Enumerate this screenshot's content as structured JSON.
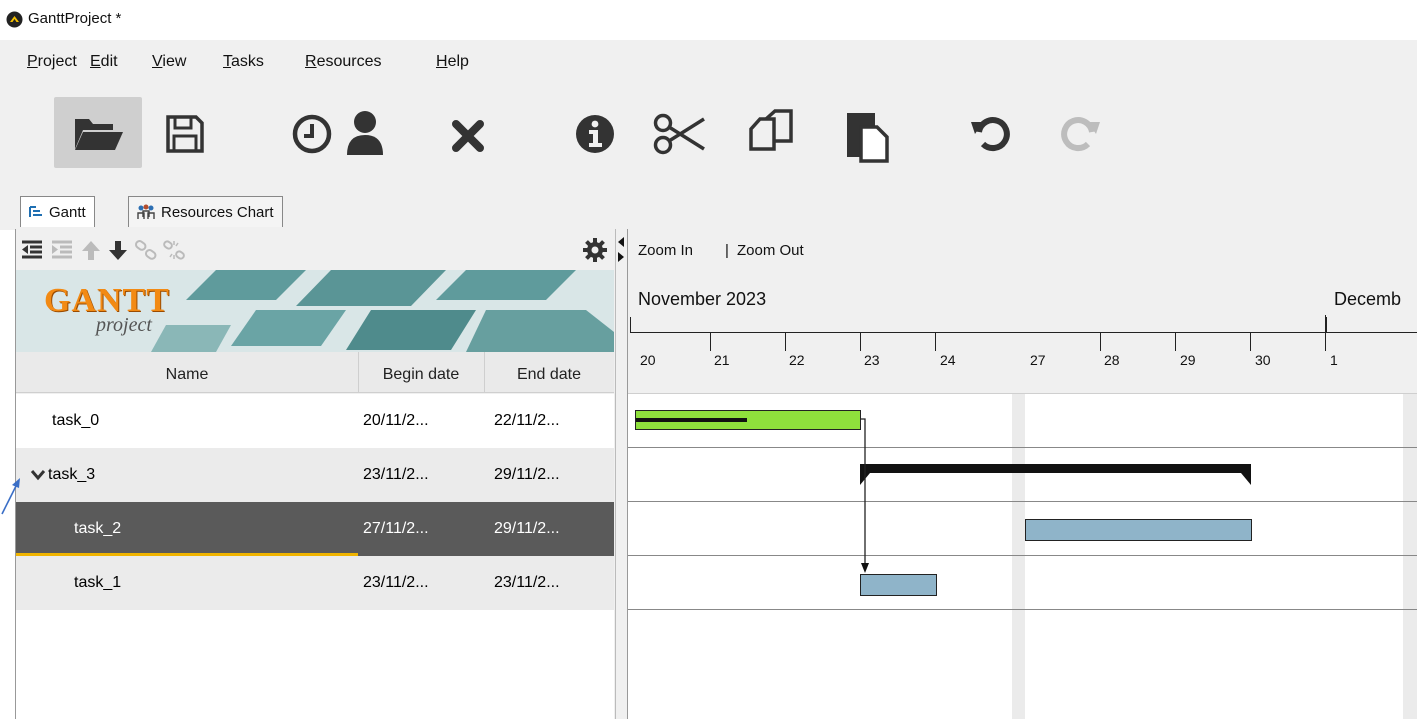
{
  "window": {
    "title": "GanttProject *"
  },
  "menu": {
    "items": [
      "Project",
      "Edit",
      "View",
      "Tasks",
      "Resources",
      "Help"
    ]
  },
  "toolbar": {
    "buttons": [
      "open-folder-icon",
      "save-icon",
      "clock-icon",
      "person-icon",
      "delete-icon",
      "info-icon",
      "cut-icon",
      "copy-icon",
      "paste-icon",
      "undo-icon",
      "redo-icon"
    ]
  },
  "tabs": {
    "gantt": "Gantt",
    "resources": "Resources Chart"
  },
  "logo": {
    "main": "GANTT",
    "sub": "project"
  },
  "table": {
    "headers": {
      "name": "Name",
      "begin": "Begin date",
      "end": "End date"
    },
    "rows": [
      {
        "name": "task_0",
        "begin": "20/11/2...",
        "end": "22/11/2..."
      },
      {
        "name": "task_3",
        "begin": "23/11/2...",
        "end": "29/11/2..."
      },
      {
        "name": "task_2",
        "begin": "27/11/2...",
        "end": "29/11/2..."
      },
      {
        "name": "task_1",
        "begin": "23/11/2...",
        "end": "23/11/2..."
      }
    ]
  },
  "chart": {
    "zoom_in": "Zoom In",
    "separator": "|",
    "zoom_out": "Zoom Out",
    "month1": "November 2023",
    "month2": "Decemb",
    "days": [
      "20",
      "21",
      "22",
      "23",
      "24",
      "27",
      "28",
      "29",
      "30",
      "1"
    ]
  },
  "colors": {
    "progress_bar": "#8fe03c",
    "task_bar": "#8fb4c9",
    "selected_row": "#5a5a5a",
    "selection_accent": "#f0b400"
  }
}
